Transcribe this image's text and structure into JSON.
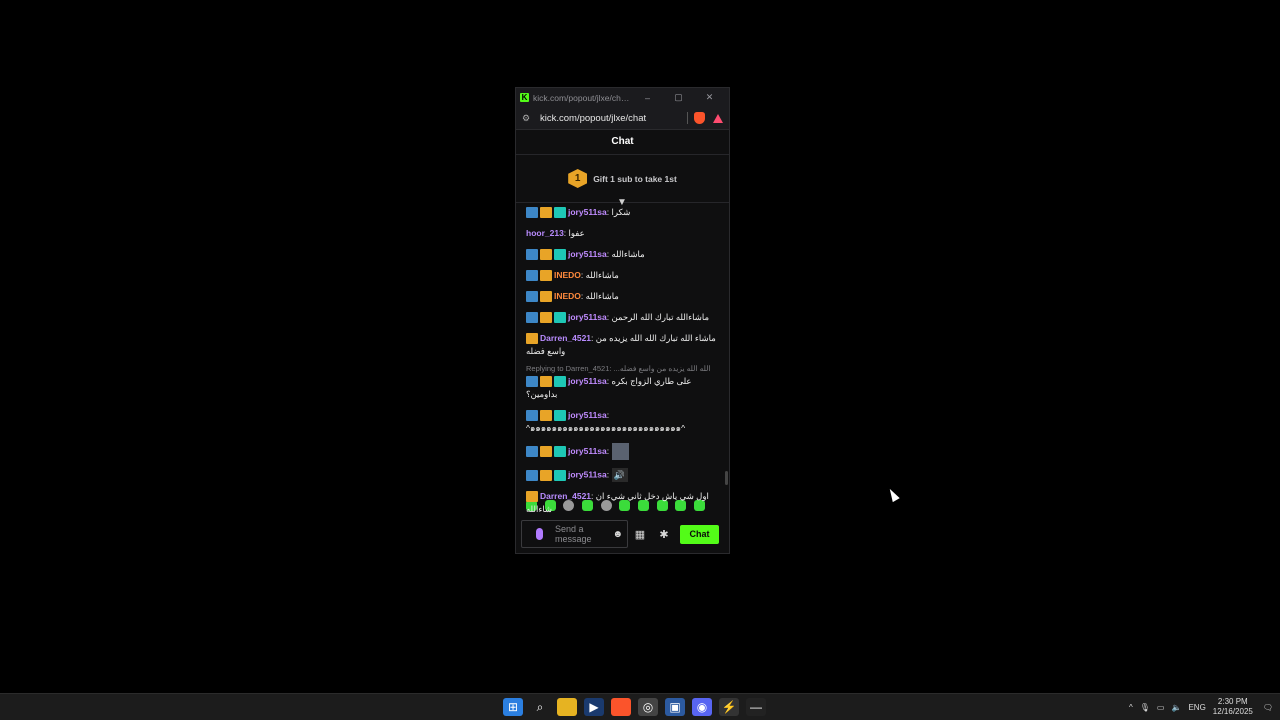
{
  "window": {
    "tab_title": "kick.com/popout/jlxe/chat - ...",
    "url": "kick.com/popout/jlxe/chat",
    "minimize": "–",
    "maximize": "▢",
    "close": "✕"
  },
  "chat": {
    "header": "Chat",
    "gift_banner": {
      "rank": "1",
      "text": "Gift 1 sub to take 1st"
    },
    "messages": [
      {
        "user": "jory511sa",
        "user_color": "#c08cff",
        "badges": [
          "blue",
          "gold",
          "teal"
        ],
        "text": "شكرا"
      },
      {
        "user": "hoor_213",
        "user_color": "#b98cff",
        "badges": [],
        "text": "عفوا"
      },
      {
        "user": "jory511sa",
        "user_color": "#c08cff",
        "badges": [
          "blue",
          "gold",
          "teal"
        ],
        "text": "ماشاءالله"
      },
      {
        "user": "INEDO",
        "user_color": "#ff8a3d",
        "badges": [
          "blue",
          "gold"
        ],
        "text": "ماشاءالله"
      },
      {
        "user": "INEDO",
        "user_color": "#ff8a3d",
        "badges": [
          "blue",
          "gold"
        ],
        "text": "ماشاءالله"
      },
      {
        "user": "jory511sa",
        "user_color": "#c08cff",
        "badges": [
          "blue",
          "gold",
          "teal"
        ],
        "text": "ماشاءالله تبارك الله الرحمن"
      },
      {
        "user": "Darren_4521",
        "user_color": "#b98cff",
        "badges": [
          "gold"
        ],
        "text": "ماشاء الله تبارك الله الله يزيده من واسع فضله"
      },
      {
        "reply_to": "Replying to Darren_4521: ...الله الله يزيده من واسع فضله",
        "user": "jory511sa",
        "user_color": "#c08cff",
        "badges": [
          "blue",
          "gold",
          "teal"
        ],
        "text": "على طاري الزواج بكره بداومين؟"
      },
      {
        "user": "jory511sa",
        "user_color": "#c08cff",
        "badges": [
          "blue",
          "gold",
          "teal"
        ],
        "text": "^๑๑๑๑๑๑๑๑๑๑๑๑๑๑๑๑๑๑๑๑๑๑๑๑๑๑๑๑^"
      },
      {
        "user": "jory511sa",
        "user_color": "#c08cff",
        "badges": [
          "blue",
          "gold",
          "teal"
        ],
        "text": "",
        "image": true
      },
      {
        "user": "jory511sa",
        "user_color": "#c08cff",
        "badges": [
          "blue",
          "gold",
          "teal"
        ],
        "text": "",
        "emote": "🔊"
      },
      {
        "user": "Darren_4521",
        "user_color": "#b98cff",
        "badges": [
          "gold"
        ],
        "text": "اول شي ياش دخل ثاني شيء ان شاءالله"
      }
    ],
    "input": {
      "placeholder": "Send a message",
      "send_label": "Chat"
    }
  },
  "taskbar": {
    "icons": [
      "windows-start-icon",
      "search-icon",
      "file-explorer-icon",
      "steam-icon",
      "brave-icon",
      "chrome-icon",
      "settings-app-icon",
      "discord-icon",
      "app-icon",
      "terminal-icon"
    ],
    "language": "ENG",
    "time": "2:30 PM",
    "date": "12/16/2025"
  },
  "colors": {
    "kick_green": "#53fc18",
    "background": "#000000"
  }
}
